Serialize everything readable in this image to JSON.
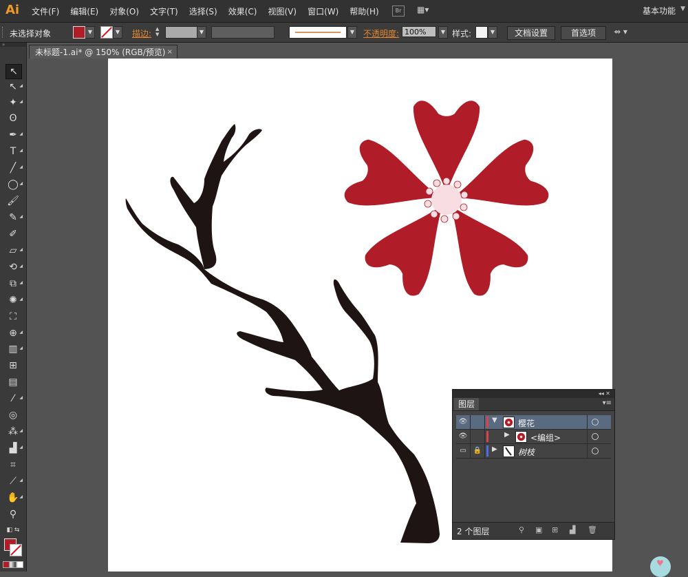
{
  "app": {
    "logo": "Ai",
    "workspace": "基本功能"
  },
  "menu": [
    "文件(F)",
    "编辑(E)",
    "对象(O)",
    "文字(T)",
    "选择(S)",
    "效果(C)",
    "视图(V)",
    "窗口(W)",
    "帮助(H)"
  ],
  "menu_icons": {
    "bridge": "Br",
    "layout": "▦▾"
  },
  "control": {
    "selection_status": "未选择对象",
    "stroke_label": "描边:",
    "opacity_label": "不透明度:",
    "opacity_value": "100%",
    "style_label": "样式:",
    "doc_setup_button": "文档设置",
    "preferences_button": "首选项"
  },
  "document_tab": {
    "title": "未标题-1.ai* @ 150% (RGB/预览)",
    "close": "×"
  },
  "colors": {
    "petal": "#b01c27",
    "center": "#f8dde3",
    "branch": "#1f1414",
    "accent": "#f29a22"
  },
  "layers_panel": {
    "tab": "图层",
    "count": "2 个图层",
    "rows": [
      {
        "name": "樱花",
        "color": "#d9434b",
        "expanded": true,
        "selected": true,
        "locked": false
      },
      {
        "name": "<编组>",
        "color": "#d9434b",
        "expanded": false,
        "selected": false,
        "locked": false
      },
      {
        "name": "树枝",
        "color": "#4e6ee8",
        "expanded": false,
        "selected": false,
        "locked": true
      }
    ]
  },
  "tools": [
    "selection-tool",
    "direct-selection-tool",
    "magic-wand-tool",
    "lasso-tool",
    "pen-tool",
    "type-tool",
    "line-tool",
    "ellipse-tool",
    "paintbrush-tool",
    "pencil-tool",
    "blob-brush-tool",
    "eraser-tool",
    "rotate-tool",
    "scale-tool",
    "warp-tool",
    "free-transform-tool",
    "shape-builder-tool",
    "perspective-grid-tool",
    "mesh-tool",
    "gradient-tool",
    "eyedropper-tool",
    "blend-tool",
    "symbol-sprayer-tool",
    "column-graph-tool",
    "artboard-tool",
    "slice-tool",
    "hand-tool",
    "zoom-tool"
  ]
}
